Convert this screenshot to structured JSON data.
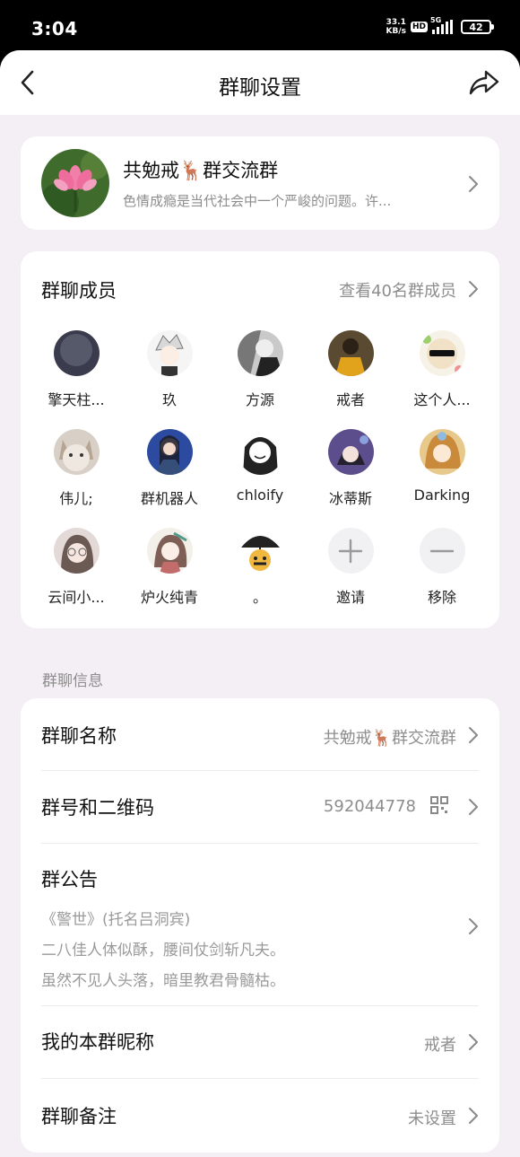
{
  "status_bar": {
    "time": "3:04",
    "net_speed_value": "33.1",
    "net_speed_unit": "KB/s",
    "hd": "HD",
    "network": "5G",
    "battery": "42"
  },
  "nav": {
    "title": "群聊设置"
  },
  "group": {
    "name": "共勉戒🦌群交流群",
    "description": "色情成瘾是当代社会中一个严峻的问题。许..."
  },
  "members": {
    "title": "群聊成员",
    "view_all": "查看40名群成员",
    "list": [
      {
        "name": "擎天柱..."
      },
      {
        "name": "玖"
      },
      {
        "name": "方源"
      },
      {
        "name": "戒者"
      },
      {
        "name": "这个人..."
      },
      {
        "name": "伟儿;"
      },
      {
        "name": "群机器人"
      },
      {
        "name": "chloify"
      },
      {
        "name": "冰蒂斯"
      },
      {
        "name": "Darking"
      },
      {
        "name": "云间小..."
      },
      {
        "name": "炉火纯青"
      },
      {
        "name": "。"
      }
    ],
    "invite_label": "邀请",
    "remove_label": "移除"
  },
  "info": {
    "section_label": "群聊信息",
    "group_name_label": "群聊名称",
    "group_name_value": "共勉戒🦌群交流群",
    "group_id_label": "群号和二维码",
    "group_id_value": "592044778",
    "notice_label": "群公告",
    "notice_lines": [
      "《警世》(托名吕洞宾)",
      "二八佳人体似酥，腰间仗剑斩凡夫。",
      "虽然不见人头落，暗里教君骨髓枯。"
    ],
    "nickname_label": "我的本群昵称",
    "nickname_value": "戒者",
    "remark_label": "群聊备注",
    "remark_value": "未设置"
  }
}
